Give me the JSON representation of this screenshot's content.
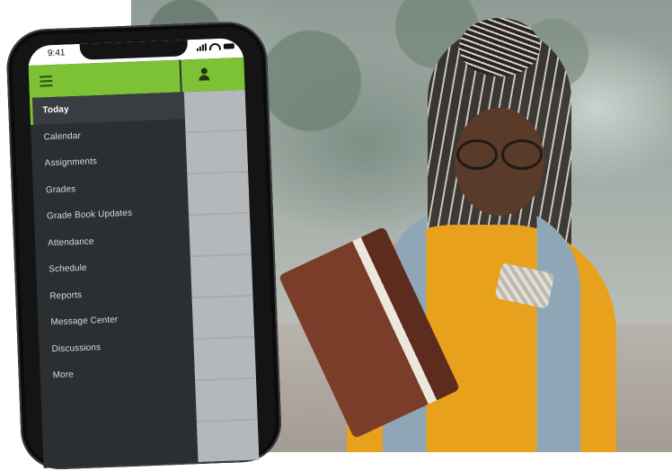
{
  "status_bar": {
    "time": "9:41"
  },
  "app_bar": {
    "menu_icon": "hamburger-menu-icon",
    "user_icon": "user-icon",
    "accent_color": "#7cc234"
  },
  "menu": {
    "items": [
      {
        "label": "Today",
        "active": true
      },
      {
        "label": "Calendar"
      },
      {
        "label": "Assignments"
      },
      {
        "label": "Grades"
      },
      {
        "label": "Grade Book Updates"
      },
      {
        "label": "Attendance"
      },
      {
        "label": "Schedule"
      },
      {
        "label": "Reports"
      },
      {
        "label": "Message Center"
      },
      {
        "label": "Discussions"
      },
      {
        "label": "More"
      }
    ]
  }
}
